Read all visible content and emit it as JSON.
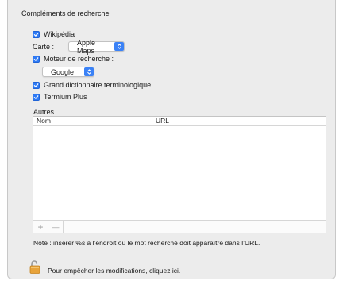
{
  "section": {
    "title": "Compléments de recherche"
  },
  "options": {
    "wikipedia": {
      "label": "Wikipédia",
      "checked": true
    },
    "map": {
      "label": "Carte :",
      "value": "Apple Maps"
    },
    "search_engine": {
      "label": "Moteur de recherche :",
      "checked": true,
      "value": "Google"
    },
    "gdt": {
      "label": "Grand dictionnaire terminologique",
      "checked": true
    },
    "termium": {
      "label": "Termium Plus",
      "checked": true
    }
  },
  "others": {
    "label": "Autres",
    "columns": [
      "Nom",
      "URL"
    ],
    "rows": [],
    "add_label": "+",
    "remove_label": "—"
  },
  "note": "Note : insérer %s à l’endroit où le mot recherché doit apparaître dans l’URL.",
  "lock": {
    "text": "Pour empêcher les modifications, cliquez ici."
  },
  "colors": {
    "accent": "#2f7bf5",
    "lock": "#e8a33a"
  }
}
